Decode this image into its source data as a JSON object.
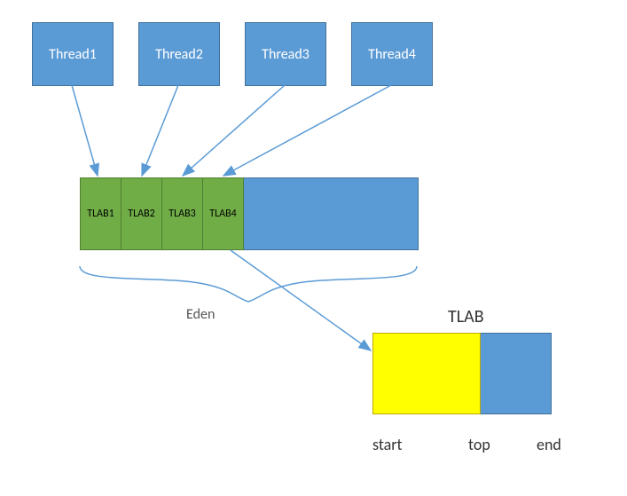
{
  "threads": [
    {
      "label": "Thread1"
    },
    {
      "label": "Thread2"
    },
    {
      "label": "Thread3"
    },
    {
      "label": "Thread4"
    }
  ],
  "tlabs": [
    {
      "label": "TLAB1"
    },
    {
      "label": "TLAB2"
    },
    {
      "label": "TLAB3"
    },
    {
      "label": "TLAB4"
    }
  ],
  "eden_label": "Eden",
  "tlab_detail": {
    "title": "TLAB",
    "markers": {
      "start": "start",
      "top": "top",
      "end": "end"
    }
  },
  "chart_data": {
    "type": "diagram",
    "description": "Thread-Local Allocation Buffers (TLABs) inside JVM Eden space. Each thread owns one TLAB segment at the start of Eden. A TLAB has start, top (current allocation pointer), and end markers.",
    "thread_count": 4,
    "tlab_count": 4,
    "tlab_detail_fill_fraction": 0.6
  }
}
